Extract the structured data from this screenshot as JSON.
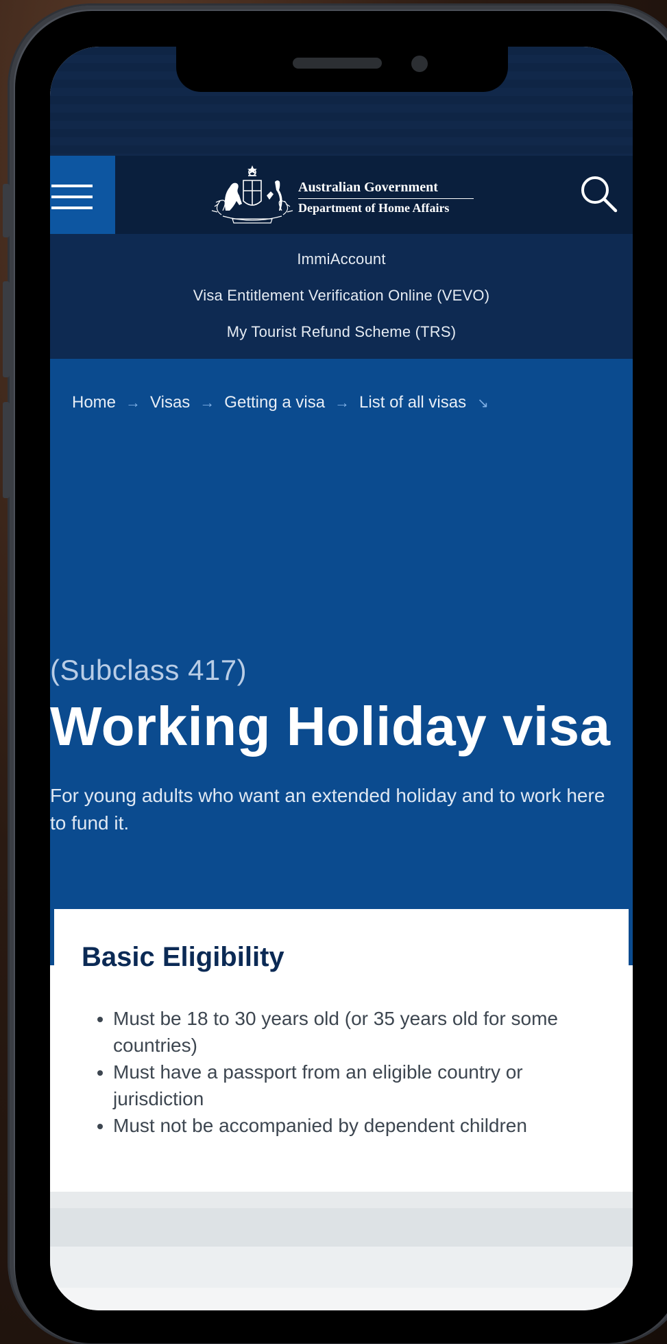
{
  "header": {
    "gov_title": "Australian Government",
    "gov_department": "Department of Home Affairs"
  },
  "quick_links": [
    "ImmiAccount",
    "Visa Entitlement Verification Online (VEVO)",
    "My Tourist Refund Scheme (TRS)"
  ],
  "breadcrumb": {
    "items": [
      "Home",
      "Visas",
      "Getting a visa",
      "List of all visas"
    ],
    "separator": "→",
    "dropdown_glyph": "↘"
  },
  "hero": {
    "subclass": "(Subclass 417)",
    "title": "Working Holiday visa",
    "description": "For young adults who want an extended holiday and to work here to fund it."
  },
  "eligibility": {
    "heading": "Basic Eligibility",
    "items": [
      "Must be 18 to 30 years old (or 35 years old for some countries)",
      "Must have a passport from an eligible country or jurisdiction",
      "Must not be accompanied by dependent children"
    ]
  },
  "icons": {
    "menu": "hamburger-menu-icon",
    "search": "search-icon",
    "crest": "coat-of-arms-icon"
  },
  "colors": {
    "header_bg": "#0a1f3d",
    "menu_bg": "#0d56a1",
    "hero_bg": "#0b4b8f",
    "heading_text": "#0b2a55"
  }
}
